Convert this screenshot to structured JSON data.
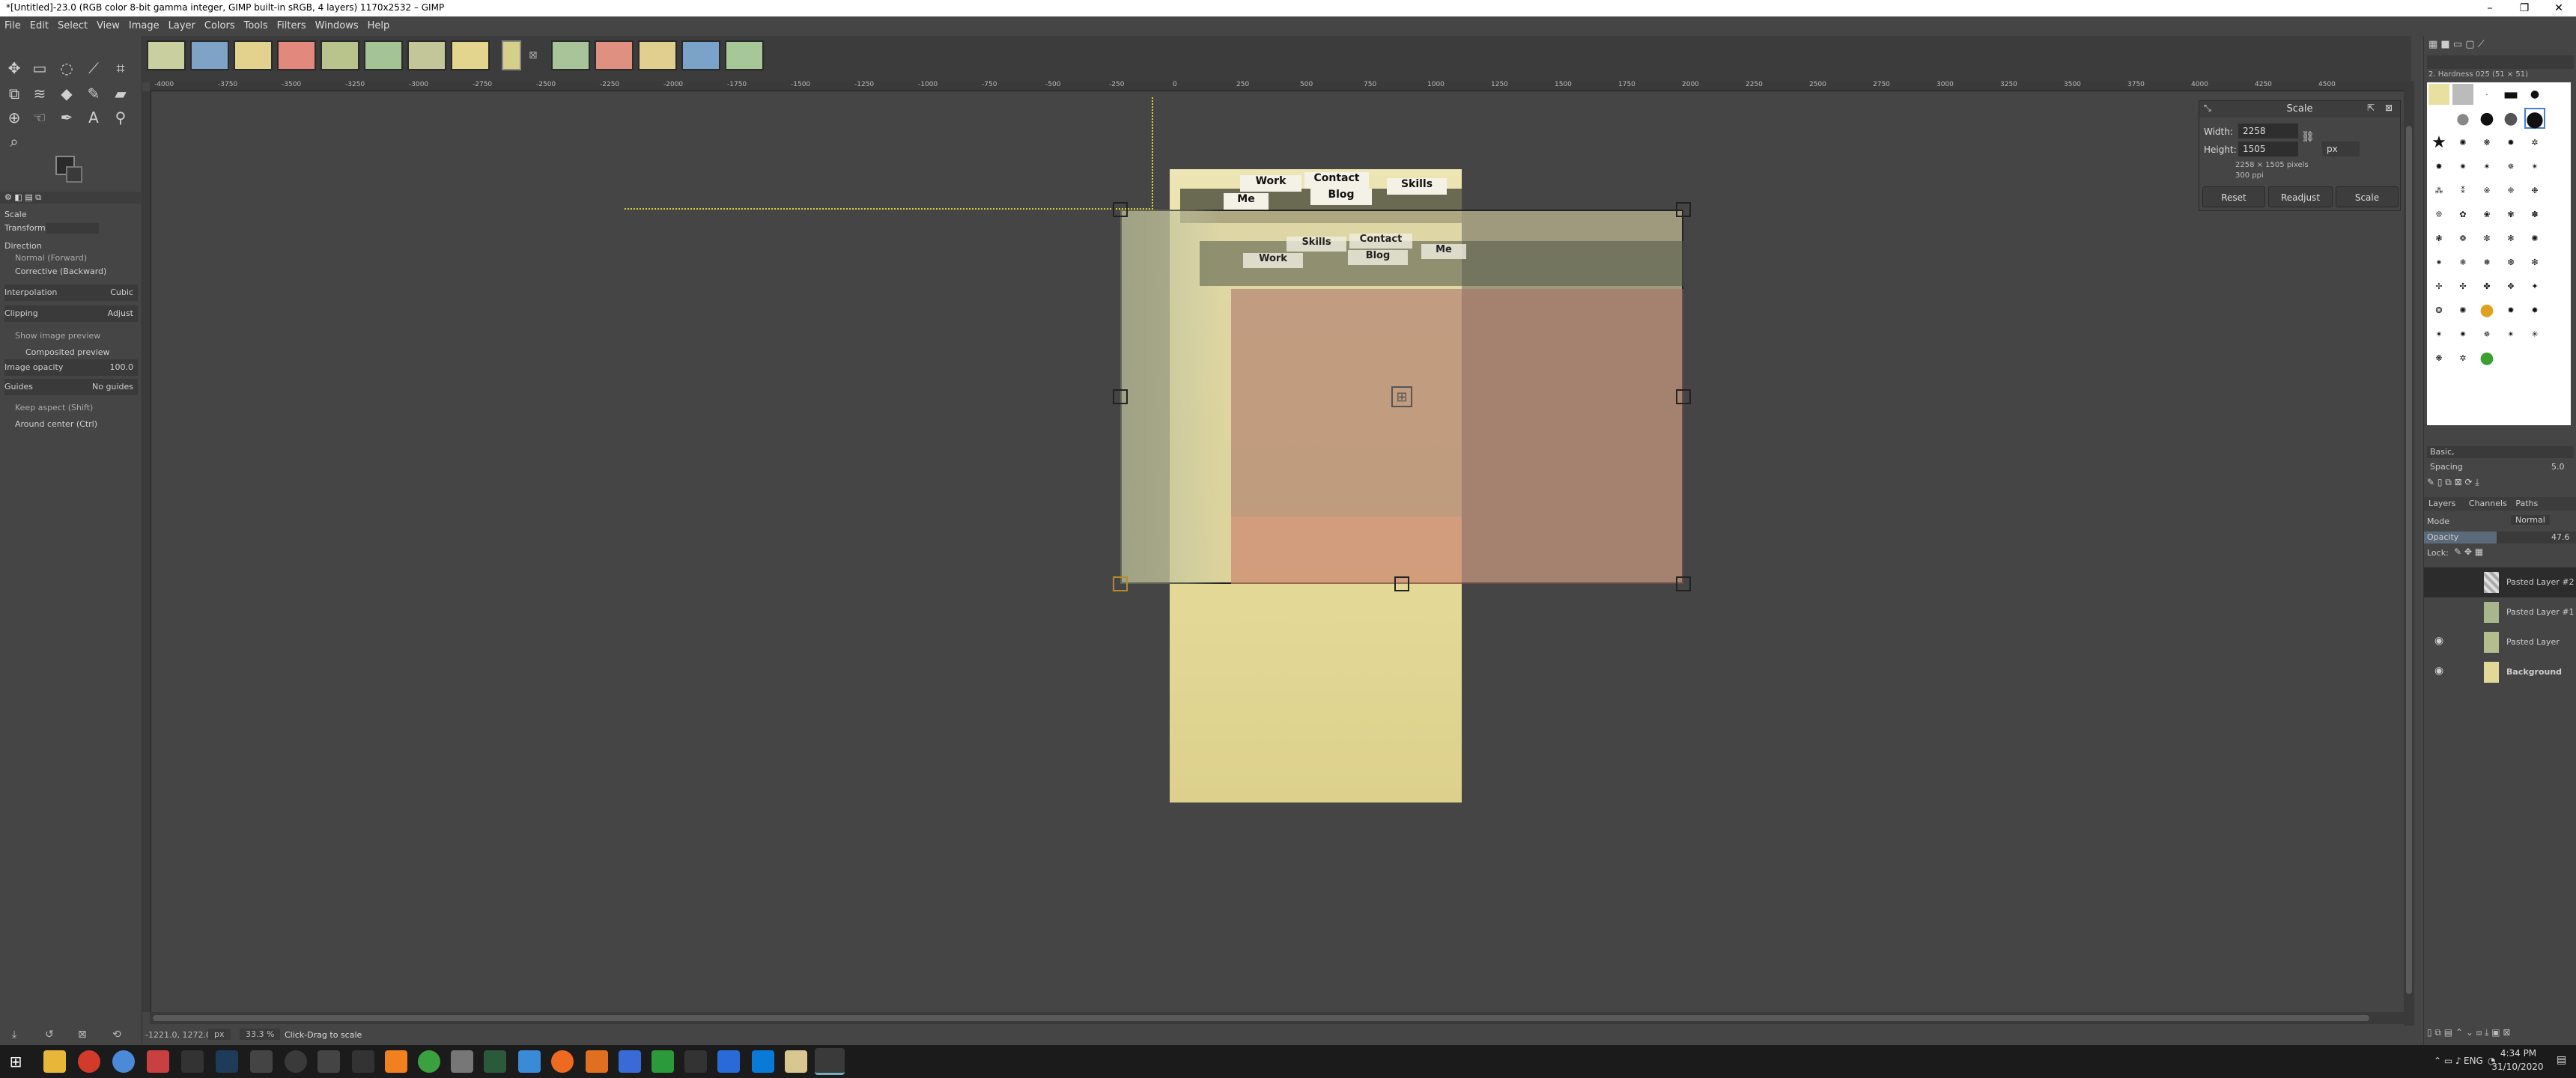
{
  "window": {
    "title": "*[Untitled]-23.0 (RGB color 8-bit gamma integer, GIMP built-in sRGB, 4 layers) 1170x2532 – GIMP",
    "minimize": "–",
    "maximize": "❐",
    "close": "✕"
  },
  "menu": [
    "File",
    "Edit",
    "Select",
    "View",
    "Image",
    "Layer",
    "Colors",
    "Tools",
    "Filters",
    "Windows",
    "Help"
  ],
  "toolbox": {
    "tool_name": "Scale",
    "transform_label": "Transform:",
    "direction_label": "Direction",
    "direction_normal": "Normal (Forward)",
    "direction_corrective": "Corrective (Backward)",
    "interpolation_label": "Interpolation",
    "interpolation_value": "Cubic",
    "clipping_label": "Clipping",
    "clipping_value": "Adjust",
    "show_preview": "Show image preview",
    "composited_preview": "Composited preview",
    "image_opacity_label": "Image opacity",
    "image_opacity_value": "100.0",
    "guides_label": "Guides",
    "guides_value": "No guides",
    "keep_aspect": "Keep aspect (Shift)",
    "around_center": "Around center (Ctrl)"
  },
  "ruler_top": [
    "-4000",
    "-3750",
    "-3500",
    "-3250",
    "-3000",
    "-2750",
    "-2500",
    "-2250",
    "-2000",
    "-1750",
    "-1500",
    "-1250",
    "-1000",
    "-750",
    "-500",
    "-250",
    "0",
    "250",
    "500",
    "750",
    "1000",
    "1250",
    "1500",
    "1750",
    "2000",
    "2250",
    "2500",
    "2750",
    "3000",
    "3250",
    "3500",
    "3750",
    "4000",
    "4250",
    "4500"
  ],
  "canvas": {
    "tabs_top": [
      "Work",
      "Contact",
      "Blog",
      "Skills",
      "Me"
    ],
    "tabs_mid": [
      "Skills",
      "Contact",
      "Work",
      "Blog",
      "Me"
    ]
  },
  "scale_dialog": {
    "title": "Scale",
    "width_label": "Width:",
    "width_value": "2258",
    "height_label": "Height:",
    "height_value": "1505",
    "unit": "px",
    "info_pixels": "2258 × 1505 pixels",
    "info_ppi": "300 ppi",
    "reset": "Reset",
    "readjust": "Readjust",
    "scale": "Scale"
  },
  "status": {
    "coords": "-1221.0, 1272.0",
    "unit": "px",
    "zoom": "33.3 %",
    "message": "Click-Drag to scale"
  },
  "brushes": {
    "filter": "Basic,",
    "brush_name": "2. Hardness 025 (51 × 51)",
    "spacing_label": "Spacing",
    "spacing_value": "5.0"
  },
  "layers_panel": {
    "tabs": [
      "Layers",
      "Channels",
      "Paths"
    ],
    "mode_label": "Mode",
    "mode_value": "Normal",
    "opacity_label": "Opacity",
    "opacity_value": "47.6",
    "lock_label": "Lock:",
    "layers": [
      {
        "name": "Pasted Layer #2",
        "visible": false
      },
      {
        "name": "Pasted Layer #1",
        "visible": false
      },
      {
        "name": "Pasted Layer",
        "visible": true
      },
      {
        "name": "Background",
        "visible": true
      }
    ]
  },
  "clock": {
    "lang": "ENG",
    "time": "4:34 PM",
    "date": "31/10/2020"
  }
}
